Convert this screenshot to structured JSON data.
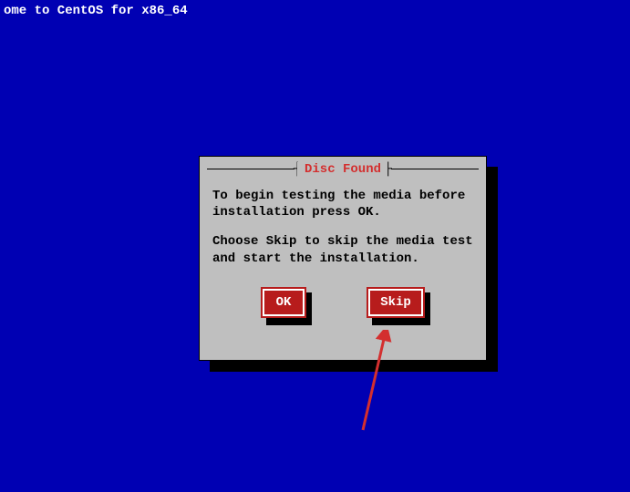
{
  "header": {
    "welcome": "ome to CentOS for x86_64"
  },
  "dialog": {
    "title": "Disc Found",
    "paragraph1": "To begin testing the media before installation press OK.",
    "paragraph2": "Choose Skip to skip the media test and start the installation.",
    "buttons": {
      "ok": "OK",
      "skip": "Skip"
    }
  }
}
